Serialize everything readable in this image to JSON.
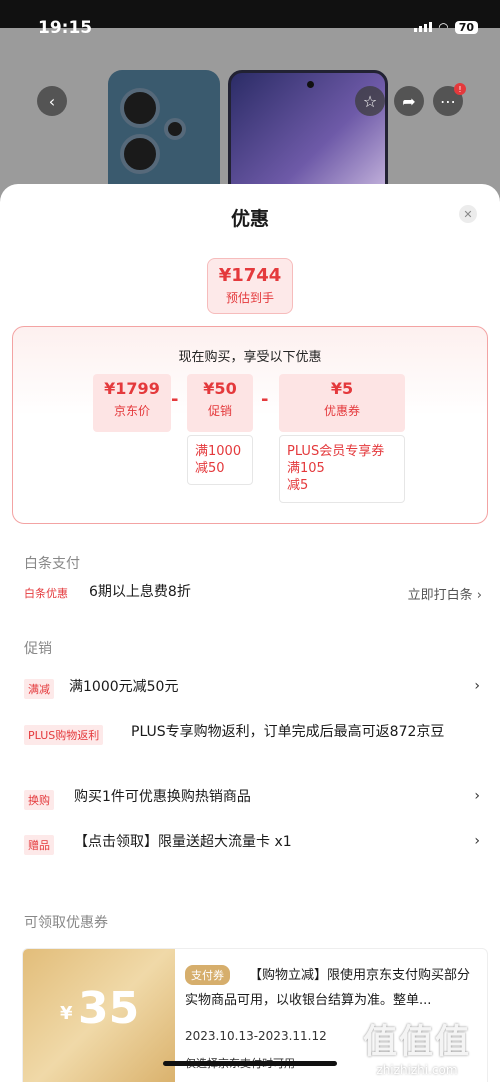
{
  "status_bar": {
    "time": "19:15",
    "battery": "70"
  },
  "sheet": {
    "title": "优惠"
  },
  "summary": {
    "price": "¥1744",
    "label": "预估到手"
  },
  "calc": {
    "heading": "现在购买，享受以下优惠",
    "items": [
      {
        "value": "¥1799",
        "label": "京东价"
      },
      {
        "value": "¥50",
        "label": "促销"
      },
      {
        "value": "¥5",
        "label": "优惠券"
      }
    ],
    "operator": "-",
    "promo_detail": [
      "满1000",
      "减50"
    ],
    "coupon_detail": [
      "PLUS会员专享券",
      "满105",
      "减5"
    ]
  },
  "baitiao": {
    "section_title": "白条支付",
    "tag": "白条优惠",
    "text": "6期以上息费8折",
    "link": "立即打白条"
  },
  "promotions": {
    "section_title": "促销",
    "items": [
      {
        "tag": "满减",
        "text": "满1000元减50元"
      },
      {
        "tag": "PLUS购物返利",
        "text": "PLUS专享购物返利，订单完成后最高可返872京豆"
      },
      {
        "tag": "换购",
        "text": "购买1件可优惠换购热销商品"
      },
      {
        "tag": "赠品",
        "text": "【点击领取】限量送超大流量卡 x1"
      }
    ]
  },
  "coupons": {
    "section_title": "可领取优惠券",
    "items": [
      {
        "yen": "¥",
        "amount": "35",
        "type_badge": "支付券",
        "desc": "【购物立减】限使用京东支付购买部分实物商品可用，以收银台结算为准。整单...",
        "date": "2023.10.13-2023.11.12",
        "note": "仅选择京东支付时可用"
      }
    ]
  },
  "watermark": {
    "logo": "值值值",
    "site": "zhizhizhi.com"
  }
}
